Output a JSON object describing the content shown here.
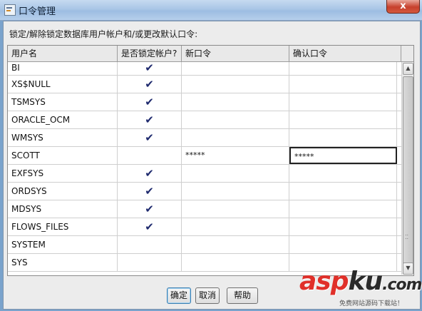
{
  "window": {
    "title": "口令管理",
    "close_glyph": "x"
  },
  "instruction": "锁定/解除锁定数据库用户帐户和/或更改默认口令:",
  "table": {
    "columns": [
      "用户名",
      "是否锁定帐户?",
      "新口令",
      "确认口令"
    ],
    "rows": [
      {
        "user": "BI",
        "locked": "✔",
        "new_password": "",
        "confirm_password": ""
      },
      {
        "user": "XS$NULL",
        "locked": "✔",
        "new_password": "",
        "confirm_password": ""
      },
      {
        "user": "TSMSYS",
        "locked": "✔",
        "new_password": "",
        "confirm_password": ""
      },
      {
        "user": "ORACLE_OCM",
        "locked": "✔",
        "new_password": "",
        "confirm_password": ""
      },
      {
        "user": "WMSYS",
        "locked": "✔",
        "new_password": "",
        "confirm_password": ""
      },
      {
        "user": "SCOTT",
        "locked": "",
        "new_password": "*****",
        "confirm_password": "*****"
      },
      {
        "user": "EXFSYS",
        "locked": "✔",
        "new_password": "",
        "confirm_password": ""
      },
      {
        "user": "ORDSYS",
        "locked": "✔",
        "new_password": "",
        "confirm_password": ""
      },
      {
        "user": "MDSYS",
        "locked": "✔",
        "new_password": "",
        "confirm_password": ""
      },
      {
        "user": "FLOWS_FILES",
        "locked": "✔",
        "new_password": "",
        "confirm_password": ""
      },
      {
        "user": "SYSTEM",
        "locked": "",
        "new_password": "",
        "confirm_password": ""
      },
      {
        "user": "SYS",
        "locked": "",
        "new_password": "",
        "confirm_password": ""
      }
    ]
  },
  "scrollbar": {
    "up_glyph": "▲",
    "down_glyph": "▼",
    "grip_glyph": "⁚⁚"
  },
  "buttons": {
    "ok": "确定",
    "cancel": "取消",
    "help": "帮助"
  },
  "watermark": {
    "brand_asp": "asp",
    "brand_ku": "ku",
    "brand_dot": ".",
    "brand_com": "com",
    "tagline": "免费网站源码下载站！"
  }
}
